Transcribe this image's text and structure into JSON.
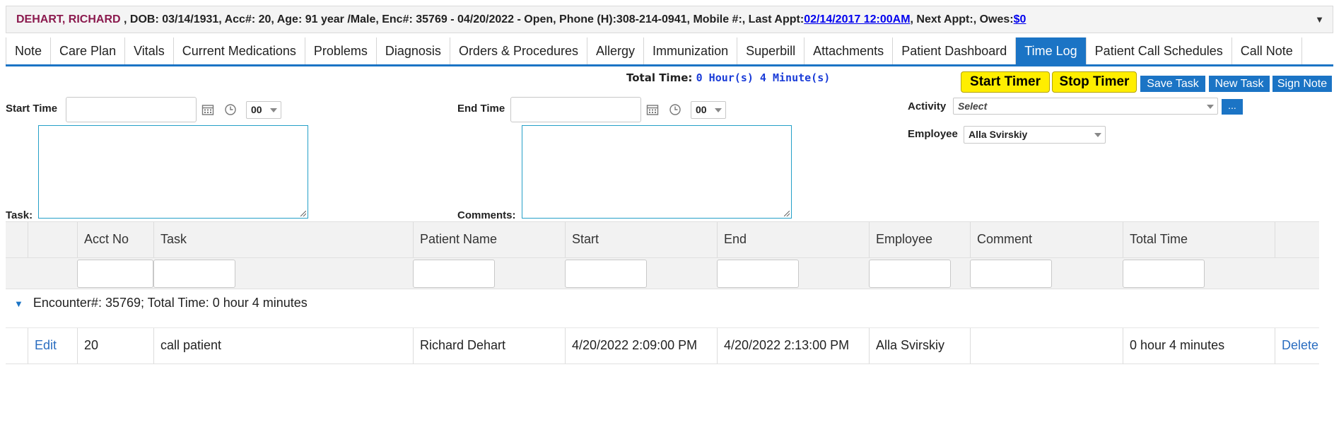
{
  "patient_bar": {
    "name": "DEHART, RICHARD",
    "details": " , DOB: 03/14/1931, Acc#: 20, Age: 91 year /Male, Enc#: 35769 - 04/20/2022 - Open, Phone (H):308-214-0941, Mobile #:, Last Appt:",
    "last_appt": "02/14/2017 12:00AM",
    "next_appt": ", Next Appt:, Owes:",
    "owes": "$0",
    "caret": "▼"
  },
  "tabs": [
    "Note",
    "Care Plan",
    "Vitals",
    "Current Medications",
    "Problems",
    "Diagnosis",
    "Orders & Procedures",
    "Allergy",
    "Immunization",
    "Superbill",
    "Attachments",
    "Patient Dashboard",
    "Time Log",
    "Patient Call Schedules",
    "Call Note"
  ],
  "active_tab": "Time Log",
  "form": {
    "total_time_label": "Total Time:",
    "total_time_value": "0 Hour(s) 4 Minute(s)",
    "start_time_label": "Start Time",
    "start_time_value": "",
    "start_minute": "00",
    "end_time_label": "End Time",
    "end_time_value": "",
    "end_minute": "00",
    "task_label": "Task:",
    "comments_label": "Comments:",
    "activity_label": "Activity",
    "activity_value": "Select",
    "activity_more": "...",
    "employee_label": "Employee",
    "employee_value": "Alla Svirskiy"
  },
  "buttons": {
    "start_timer": "Start Timer",
    "stop_timer": "Stop Timer",
    "save_task": "Save Task",
    "new_task": "New Task",
    "sign_note": "Sign Note"
  },
  "grid": {
    "columns": [
      "Acct No",
      "Task",
      "Patient Name",
      "Start",
      "End",
      "Employee",
      "Comment",
      "Total Time"
    ],
    "group_label": "Encounter#: 35769; Total Time: 0 hour 4 minutes",
    "rows": [
      {
        "edit": "Edit",
        "acct_no": "20",
        "task": "call patient",
        "patient_name": "Richard Dehart",
        "start": "4/20/2022 2:09:00 PM",
        "end": "4/20/2022 2:13:00 PM",
        "employee": "Alla Svirskiy",
        "comment": "",
        "total_time": "0 hour 4 minutes",
        "delete": "Delete"
      }
    ]
  },
  "colors": {
    "accent": "#1b74c5",
    "timer_button": "#ffee00",
    "patient_name": "#8b1a4e",
    "total_time_value": "#1a3cd8"
  }
}
